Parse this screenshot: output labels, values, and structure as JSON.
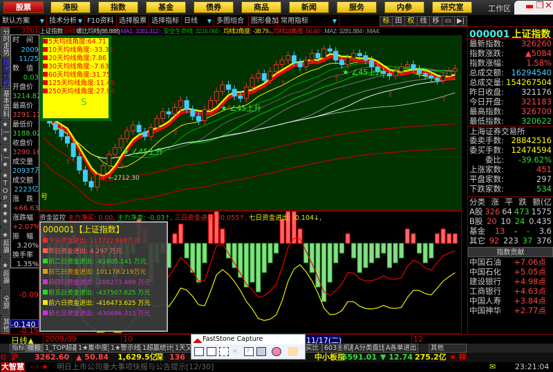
{
  "topnav": {
    "items": [
      "股票",
      "港股",
      "指数",
      "基金",
      "债券",
      "商品",
      "新闻",
      "服务",
      "内参",
      "研究室"
    ],
    "active": 0,
    "workspace": "工作区"
  },
  "toolbar": {
    "items": [
      "默认方案",
      "技术分析",
      "F10资料",
      "选择股票",
      "选择指标",
      "日线",
      "多图组合",
      "图形叠加",
      "常用指标"
    ],
    "toggles": [
      "标",
      "田",
      "权",
      "线",
      "移",
      "▭",
      "▶|"
    ]
  },
  "sidetabs": [
    "分时走势",
    "技术分析",
    "基本资料",
    "★一★招",
    "★一★招",
    "★TOP",
    "★★★",
    "★超赢",
    "★超赢",
    "全屏",
    "其他"
  ],
  "info": {
    "time_label": "时　间",
    "date1": "2009",
    "date2": "11/25",
    "value_label": "数　值",
    "value": "0.03",
    "open_label": "开盘价",
    "open": "3214.82",
    "high_label": "最高价",
    "high": "3291.17",
    "low_label": "最低价",
    "low": "3188.02",
    "close_label": "收盘价",
    "close": "3290.16",
    "vol_label": "成交量",
    "vol": "20937万",
    "amt_label": "成交额",
    "amt": "2223亿",
    "chg_label": "涨　跌",
    "chg": "+66.63",
    "pct_label": "涨跌幅",
    "pct": "+2.07%",
    "amp_label": "振　幅",
    "amp": "3.20%",
    "turn_label": "换手率",
    "turn": "1.35%"
  },
  "main_header": {
    "price_tag": "3261",
    "name": "上证指数",
    "period": "日线",
    "indicator": "螺比均线(88,888)",
    "ma1": "MA1: 3281.312↑,",
    "life": "安全生命线: 3216.065↑,",
    "ang3": "均线3角度: -38.79↓,",
    "ang18": "均线18角度: 56.60↑,",
    "ma2": "MA2: 3281.884↑,",
    "ma4": "MA4:"
  },
  "angles": [
    "5天均线角度:64.71",
    "10天均线角度:-33.33",
    "20天均线角度:7.86",
    "30天均线角度:-7.63",
    "60天均线角度:31.75",
    "125天均线角度:11.49",
    "250天均线角度:27.94"
  ],
  "angle_s": "S",
  "chart_labels": {
    "low": "2712.30",
    "rise": "45上升",
    "signal": "号"
  },
  "lower_header": {
    "title": "资金监控",
    "buy": "主力净买: 0.00,",
    "sell": "主力净卖: -0.03↑,",
    "three": "三日资金进出: -0.055↑,",
    "seven": "七日资金进出: -0.104↓,"
  },
  "lower_axis": {
    "a": "-0.09",
    "b": "-0.140",
    "c": "-0.15"
  },
  "flow_popup": {
    "title": "000001【上证指数】",
    "rows": [
      {
        "t": "今日资金进出: 113722.688万元",
        "c": "#e03030"
      },
      {
        "t": "昨日资金进出: 4.297 万元",
        "c": "#ff6060"
      },
      {
        "t": "前二日资金进出: -61605.141 万元",
        "c": "#22dd22"
      },
      {
        "t": "前三日资金进出: 101178.219万元",
        "c": "#e0a000"
      },
      {
        "t": "前四日资金进出: -288273.469 万元",
        "c": "#cc33cc"
      },
      {
        "t": "前五日资金进出: -437507.625 万元",
        "c": "#22dd22"
      },
      {
        "t": "前六日资金进出: -416473.625 万元",
        "c": "#eeee00"
      },
      {
        "t": "前七日资金进出: -630686.313 万元",
        "c": "#cc33cc"
      }
    ]
  },
  "right": {
    "code": "000001",
    "name": "上证指数",
    "rows": [
      {
        "k": "最新指数:",
        "v": "326260",
        "c": "#f44"
      },
      {
        "k": "指数涨跌:",
        "v": "▲5084",
        "c": "#f44"
      },
      {
        "k": "指数涨幅:",
        "v": "1.58%",
        "c": "#f44"
      },
      {
        "k": "总成交额:",
        "v": "16294540",
        "c": "#4cf"
      },
      {
        "k": "总成交量:",
        "v": "154267504",
        "c": "#ff0"
      },
      {
        "k": "昨日收盘:",
        "v": "321176",
        "c": "#ccc"
      },
      {
        "k": "今日开盘:",
        "v": "321183",
        "c": "#f44"
      },
      {
        "k": "最高指数:",
        "v": "326700",
        "c": "#f44"
      },
      {
        "k": "最低指数:",
        "v": "320622",
        "c": "#3d3"
      }
    ],
    "exchange": "上海证券交易所",
    "rows2": [
      {
        "k": "委卖手数:",
        "v": "28842516",
        "c": "#ff0"
      },
      {
        "k": "委买手数:",
        "v": "12474594",
        "c": "#ff0"
      },
      {
        "k": "　　委比:",
        "v": "-39.62%",
        "c": "#3d3"
      },
      {
        "k": "上涨家数:",
        "v": "451",
        "c": "#f44"
      },
      {
        "k": "平盘家数:",
        "v": "297",
        "c": "#ccc"
      },
      {
        "k": "下跌家数:",
        "v": "534",
        "c": "#3d3"
      }
    ],
    "table": {
      "headers": [
        "分类",
        "涨",
        "平",
        "跌",
        "额(亿"
      ],
      "rows": [
        [
          "A股",
          "326",
          "64",
          "473",
          "1575"
        ],
        [
          "B股",
          "20",
          "10",
          "24",
          "0.435"
        ],
        [
          "基金",
          "13",
          "-",
          "-",
          "3.6"
        ],
        [
          "其它",
          "92",
          "223",
          "37",
          "376"
        ]
      ]
    },
    "contrib_title": "指数贡献",
    "contrib": [
      {
        "n": "中国石油",
        "v": "+7.06点"
      },
      {
        "n": "中国石化",
        "v": "+5.05点"
      },
      {
        "n": "建设银行",
        "v": "+4.98点"
      },
      {
        "n": "工商银行",
        "v": "+4.63点"
      },
      {
        "n": "中国人寿",
        "v": "+3.84点"
      },
      {
        "n": "中国神华",
        "v": "+2.77点"
      }
    ]
  },
  "timeaxis": {
    "period": "日线▲",
    "labels": [
      "2009/09",
      "10",
      "11/17(二)",
      "12"
    ]
  },
  "bottom_tabs": [
    "指标",
    "模板",
    "1_TOP超赢",
    "1★集中度",
    "1★警示线",
    "1超赢统计",
    "1天又",
    "主净买比",
    "603主机散",
    "A分类盘比",
    "A各单进出",
    "其他"
  ],
  "ticker": {
    "sh": "沪",
    "sh_val": "3262.60",
    "sh_chg": "▲ 50.84",
    "sh_amt": "1,629.5亿",
    "sz": "深",
    "sz_val": "136",
    "zx": "中小板指",
    "zx_val": "5591.01",
    "zx_chg": "▼ 12.74",
    "zx_amt": "275.2亿",
    "star": "★ 祥"
  },
  "news": {
    "brand": "大智慧",
    "text": "明日上市公司重大事项快报与公告提示[12/30]",
    "time": "23:21:04"
  },
  "capture": {
    "title": "FastStone Capture"
  },
  "chart_data": {
    "type": "candlestick",
    "ylim": [
      2650,
      3420
    ],
    "closes": [
      3080,
      3020,
      2990,
      2960,
      2930,
      2870,
      2810,
      2760,
      2735,
      2790,
      2830,
      2880,
      2910,
      2950,
      2985,
      3010,
      2980,
      2960,
      3000,
      3040,
      3070,
      3060,
      3090,
      3120,
      3080,
      3050,
      3030,
      3080,
      3120,
      3160,
      3190,
      3170,
      3140,
      3130,
      3180,
      3220,
      3240,
      3210,
      3250,
      3280,
      3300,
      3320,
      3290,
      3270,
      3300,
      3330,
      3310,
      3350,
      3340,
      3300,
      3280,
      3310,
      3330,
      3320,
      3300,
      3270,
      3250,
      3240,
      3230,
      3250,
      3270,
      3280,
      3260,
      3240,
      3230,
      3220,
      3210,
      3230,
      3250,
      3262
    ],
    "flow": [
      0.3,
      -0.5,
      -0.6,
      -0.8,
      -0.9,
      0.2,
      -1.4,
      -1.0,
      -0.8,
      -0.9,
      -0.6,
      -0.5,
      -0.7,
      -0.6,
      -0.3,
      -0.2,
      0.5,
      0.3,
      -0.8,
      -0.4,
      -0.2,
      -0.5,
      0.2,
      0.4,
      -0.3,
      -0.6,
      -0.8,
      -0.4,
      0.6,
      0.9,
      0.3,
      -0.3,
      -0.5,
      -0.7,
      -0.9,
      -0.8,
      -1.0,
      -0.6,
      -0.4,
      -0.2,
      0.5,
      1.0,
      0.7,
      0.3,
      -0.4,
      -0.6,
      -0.9,
      -1.2,
      -0.8,
      -0.4,
      -0.2,
      0.2,
      -0.3,
      -0.6,
      -0.5,
      -0.4,
      -0.3,
      -0.2,
      -0.5,
      -0.4,
      -0.3,
      0.3,
      0.2,
      -0.2,
      -0.4,
      -0.3,
      0.2,
      0.3,
      0.2,
      0.2
    ]
  }
}
